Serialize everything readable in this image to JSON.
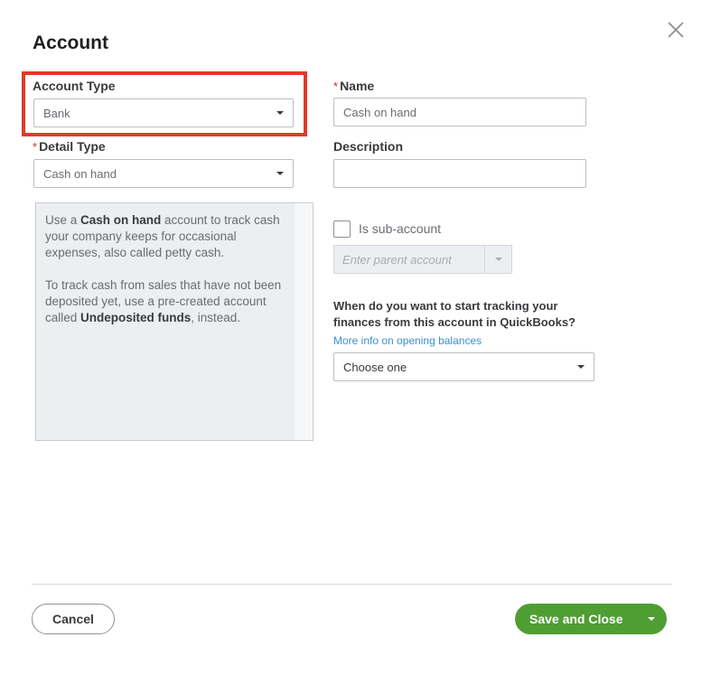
{
  "dialog": {
    "title": "Account",
    "close_icon": "close-x-icon"
  },
  "account_type": {
    "label": "Account Type",
    "value": "Bank",
    "highlighted": true,
    "highlight_color": "#e03a2a"
  },
  "detail_type": {
    "label": "Detail Type",
    "required_mark": "*",
    "value": "Cash on hand"
  },
  "name": {
    "label": "Name",
    "required_mark": "*",
    "value": "Cash on hand"
  },
  "description": {
    "label": "Description",
    "value": ""
  },
  "help_text": {
    "p1_before": "Use a ",
    "p1_bold": "Cash on hand",
    "p1_after": " account to track cash your company keeps for occasional expenses, also called petty cash.",
    "p2_before": "To track cash from sales that have not been deposited yet, use a pre-created account called ",
    "p2_bold": "Undeposited funds",
    "p2_after": ", instead."
  },
  "sub_account": {
    "label": "Is sub-account",
    "checked": false,
    "parent_placeholder": "Enter parent account"
  },
  "opening_balance": {
    "question": "When do you want to start tracking your finances from this account in QuickBooks?",
    "link": "More info on opening balances",
    "select_value": "Choose one"
  },
  "footer": {
    "cancel_label": "Cancel",
    "save_label": "Save and Close",
    "save_color": "#4f9e33"
  }
}
